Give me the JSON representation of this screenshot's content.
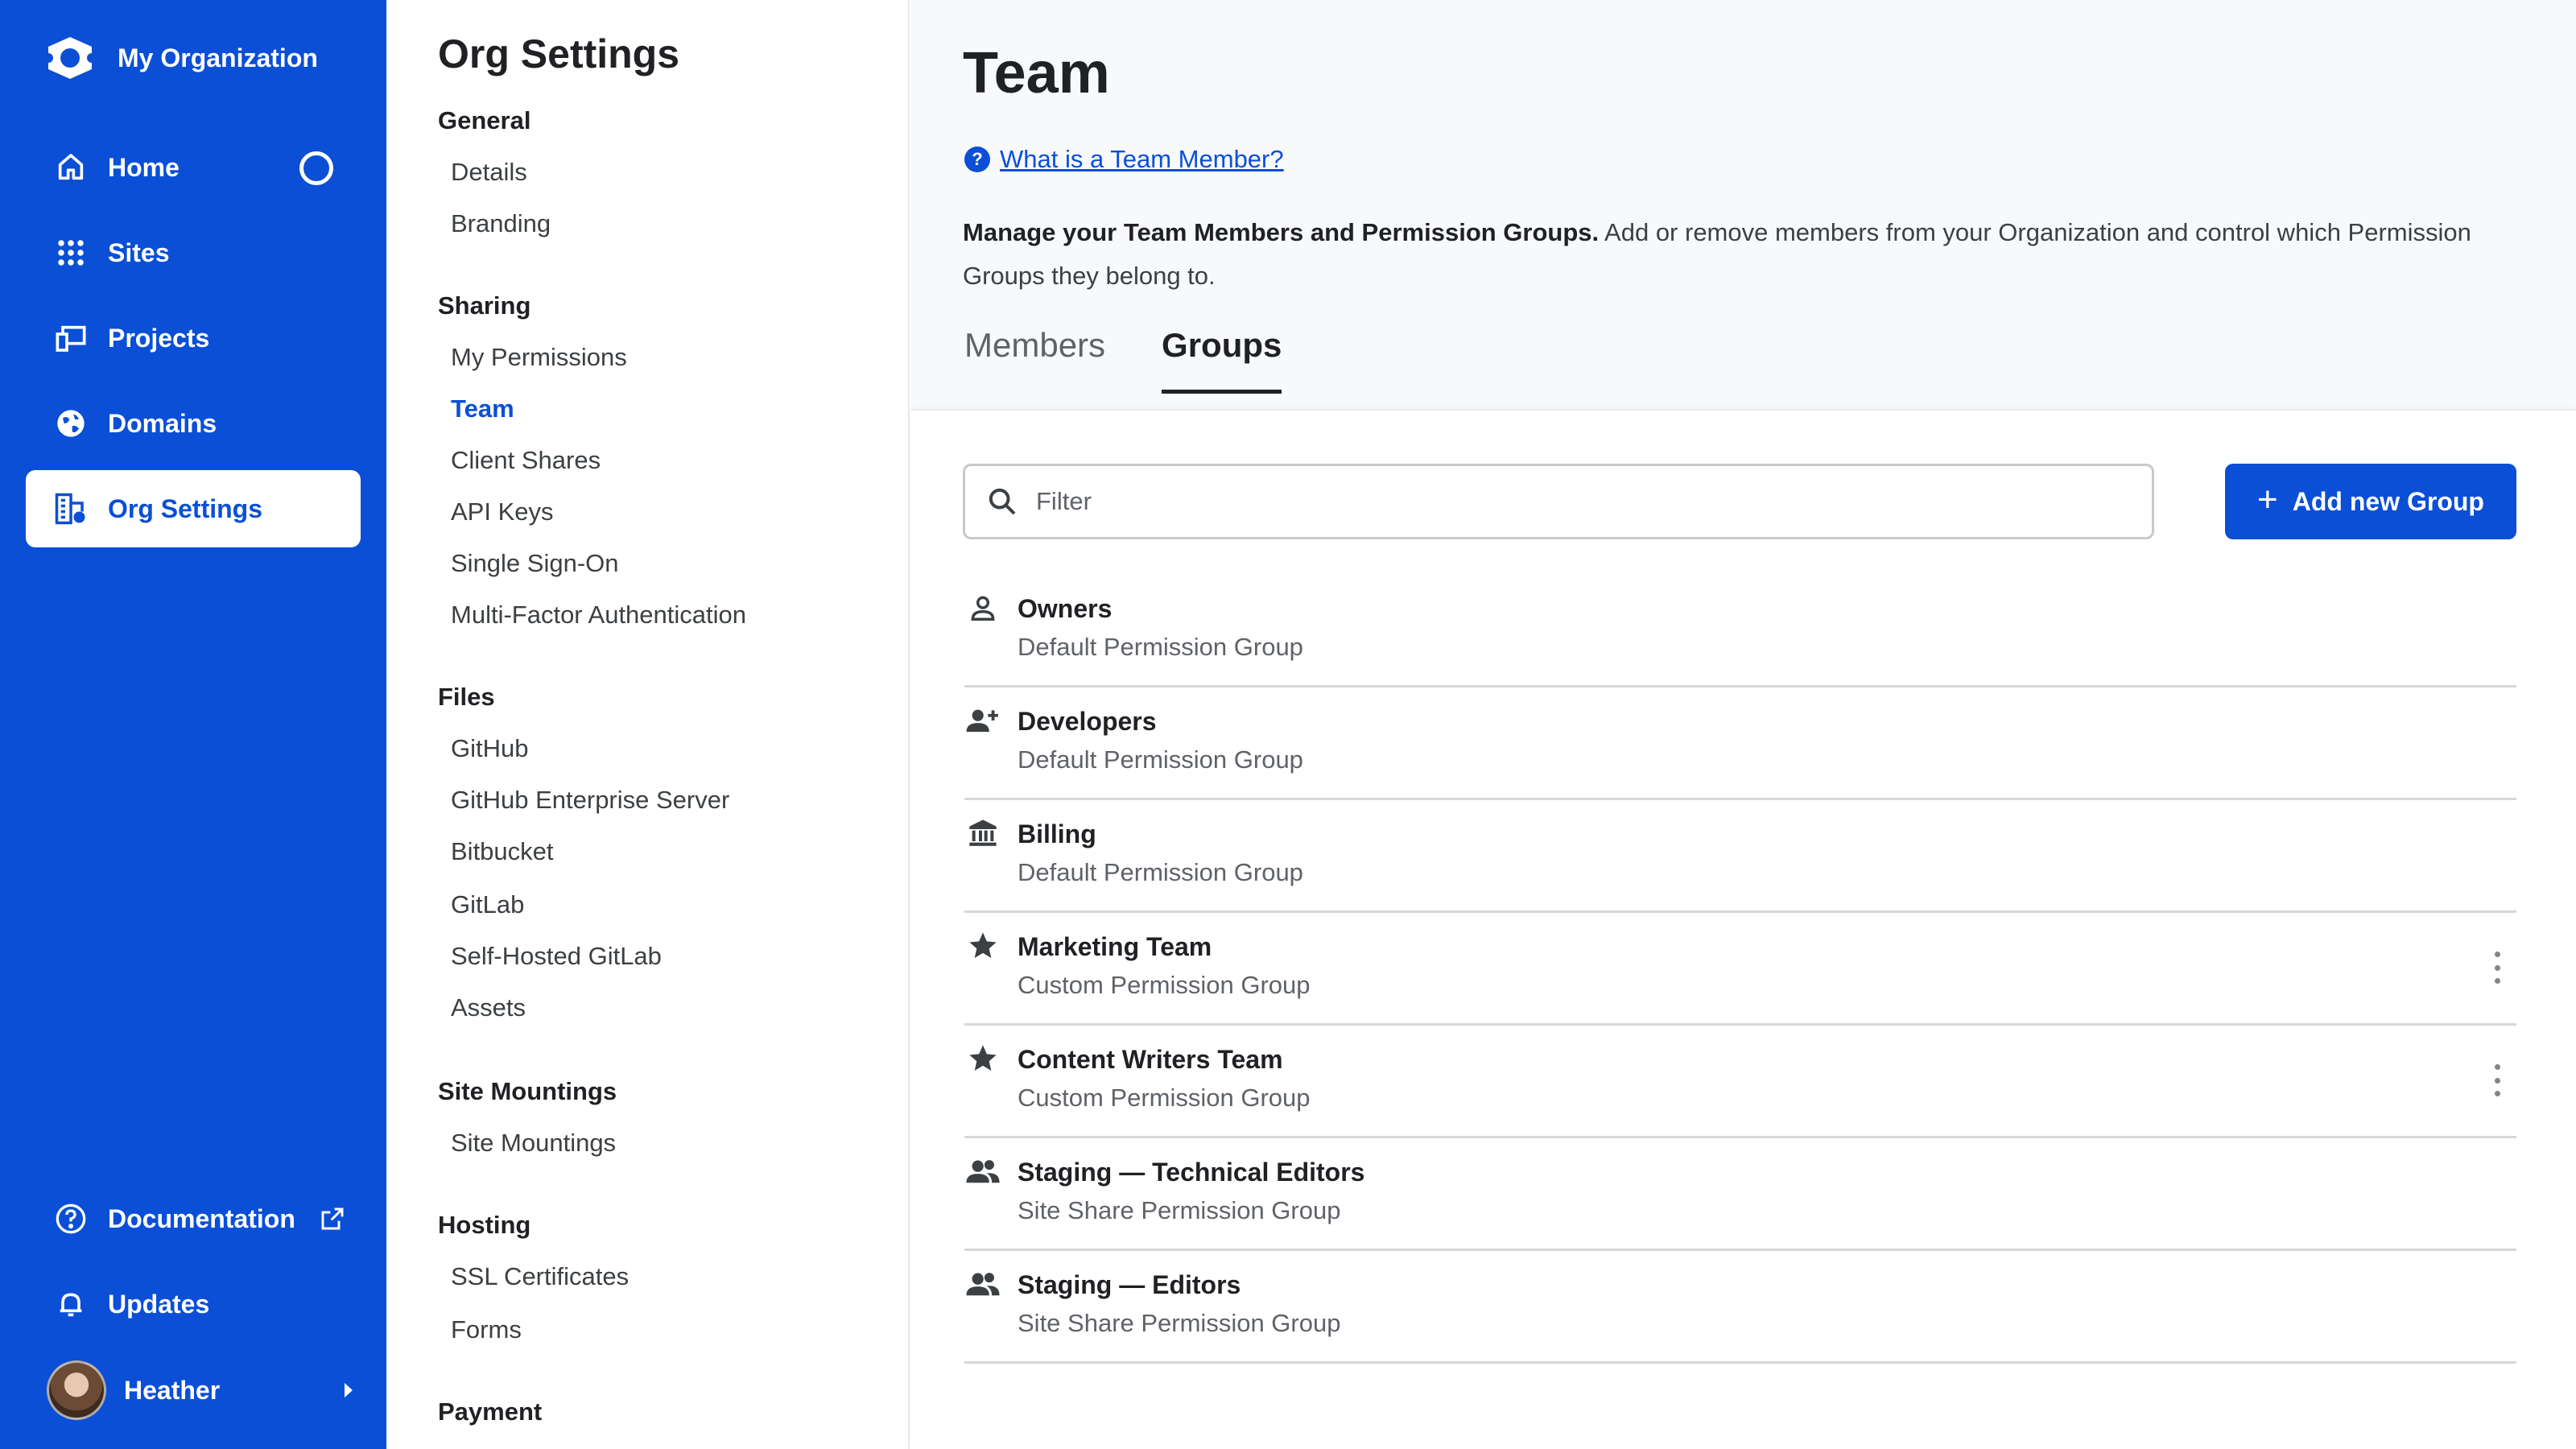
{
  "app": {
    "org_name": "My Organization"
  },
  "nav": {
    "items": [
      {
        "label": "Home",
        "icon": "home-icon"
      },
      {
        "label": "Sites",
        "icon": "grid-icon"
      },
      {
        "label": "Projects",
        "icon": "devices-icon"
      },
      {
        "label": "Domains",
        "icon": "globe-icon"
      },
      {
        "label": "Org Settings",
        "icon": "org-settings-icon"
      }
    ],
    "active": "Org Settings",
    "documentation_label": "Documentation",
    "updates_label": "Updates",
    "user_name": "Heather",
    "accent": "#0a4fd6"
  },
  "settings": {
    "title": "Org Settings",
    "sections": [
      {
        "heading": "General",
        "links": [
          "Details",
          "Branding"
        ]
      },
      {
        "heading": "Sharing",
        "links": [
          "My Permissions",
          "Team",
          "Client Shares",
          "API Keys",
          "Single Sign-On",
          "Multi-Factor Authentication"
        ]
      },
      {
        "heading": "Files",
        "links": [
          "GitHub",
          "GitHub Enterprise Server",
          "Bitbucket",
          "GitLab",
          "Self-Hosted GitLab",
          "Assets"
        ]
      },
      {
        "heading": "Site Mountings",
        "links": [
          "Site Mountings"
        ]
      },
      {
        "heading": "Hosting",
        "links": [
          "SSL Certificates",
          "Forms"
        ]
      },
      {
        "heading": "Payment",
        "links": []
      }
    ],
    "active_link": "Team"
  },
  "main": {
    "title": "Team",
    "help_link": "What is a Team Member?",
    "desc_bold": "Manage your Team Members and Permission Groups.",
    "desc_rest": " Add or remove members from your Organization and control which Permission Groups they belong to.",
    "tabs": [
      {
        "label": "Members",
        "active": false
      },
      {
        "label": "Groups",
        "active": true
      }
    ],
    "filter_placeholder": "Filter",
    "add_button": "Add new Group",
    "groups": [
      {
        "name": "Owners",
        "type": "Default Permission Group",
        "icon": "person-icon",
        "menu": false
      },
      {
        "name": "Developers",
        "type": "Default Permission Group",
        "icon": "person-add-icon",
        "menu": false
      },
      {
        "name": "Billing",
        "type": "Default Permission Group",
        "icon": "bank-icon",
        "menu": false
      },
      {
        "name": "Marketing Team",
        "type": "Custom Permission Group",
        "icon": "star-icon",
        "menu": true
      },
      {
        "name": "Content Writers Team",
        "type": "Custom Permission Group",
        "icon": "star-icon",
        "menu": true
      },
      {
        "name": "Staging — Technical Editors",
        "type": "Site Share Permission Group",
        "icon": "people-icon",
        "menu": false
      },
      {
        "name": "Staging — Editors",
        "type": "Site Share Permission Group",
        "icon": "people-icon",
        "menu": false
      }
    ]
  }
}
